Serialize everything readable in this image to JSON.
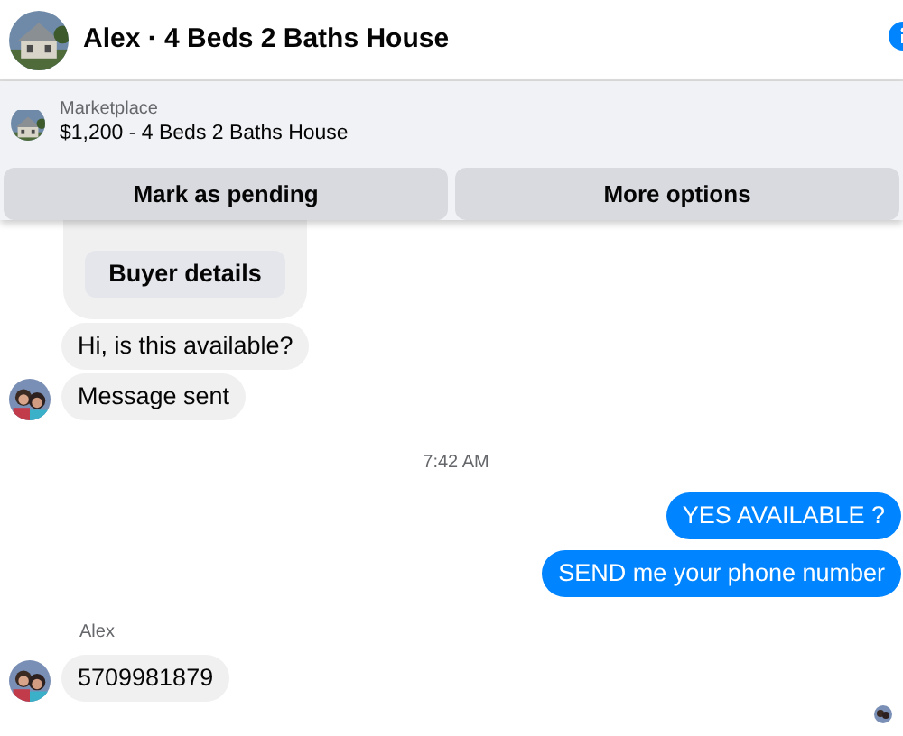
{
  "header": {
    "title": "Alex · 4 Beds 2 Baths House"
  },
  "listing": {
    "source": "Marketplace",
    "title": "$1,200 - 4 Beds 2 Baths House",
    "actions": [
      "Mark as pending",
      "More options"
    ]
  },
  "messages": [
    {
      "kind": "card",
      "button": "Buyer details"
    },
    {
      "kind": "incoming",
      "text": "Hi, is this available?",
      "avatar": false
    },
    {
      "kind": "incoming",
      "text": "Message sent",
      "avatar": true
    },
    {
      "kind": "timestamp",
      "text": "7:42 AM"
    },
    {
      "kind": "outgoing",
      "text": "YES AVAILABLE ?"
    },
    {
      "kind": "outgoing",
      "text": "SEND me your phone number"
    },
    {
      "kind": "sender",
      "text": "Alex"
    },
    {
      "kind": "incoming",
      "text": "5709981879",
      "avatar": true
    },
    {
      "kind": "receipt"
    }
  ]
}
